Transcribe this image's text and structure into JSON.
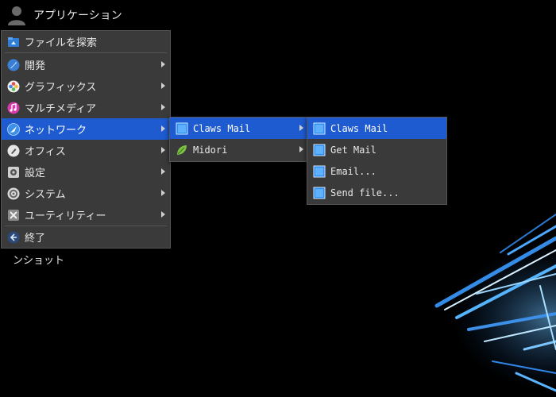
{
  "top_panel": {
    "app_menu_label": "アプリケーション",
    "user_icon": "user-icon"
  },
  "desktop": {
    "partial_icon_label": "ンショット"
  },
  "main_menu": {
    "items": [
      {
        "label": "ファイルを探索",
        "icon": "folder-icon"
      },
      {
        "label": "開発",
        "icon": "development-icon",
        "submenu": true
      },
      {
        "label": "グラフィックス",
        "icon": "graphics-icon",
        "submenu": true
      },
      {
        "label": "マルチメディア",
        "icon": "multimedia-icon",
        "submenu": true
      },
      {
        "label": "ネットワーク",
        "icon": "network-icon",
        "submenu": true,
        "active": true
      },
      {
        "label": "オフィス",
        "icon": "office-icon",
        "submenu": true
      },
      {
        "label": "設定",
        "icon": "settings-icon",
        "submenu": true
      },
      {
        "label": "システム",
        "icon": "system-icon",
        "submenu": true
      },
      {
        "label": "ユーティリティー",
        "icon": "utilities-icon",
        "submenu": true
      },
      {
        "label": "終了",
        "icon": "logout-icon"
      }
    ]
  },
  "network_menu": {
    "items": [
      {
        "label": "Claws Mail",
        "icon": "claws-mail-icon",
        "submenu": true,
        "active": true
      },
      {
        "label": "Midori",
        "icon": "midori-icon",
        "submenu": true
      }
    ]
  },
  "claws_mail_menu": {
    "items": [
      {
        "label": "Claws Mail",
        "icon": "claws-mail-icon",
        "active": true
      },
      {
        "label": "Get Mail",
        "icon": "claws-mail-icon"
      },
      {
        "label": "Email...",
        "icon": "claws-mail-icon"
      },
      {
        "label": "Send file...",
        "icon": "claws-mail-icon"
      }
    ]
  },
  "colors": {
    "menu_bg": "#3a3a3a",
    "highlight": "#1e5bd0",
    "desktop_bg": "#000000",
    "accent_light": "#4aa8ff"
  }
}
